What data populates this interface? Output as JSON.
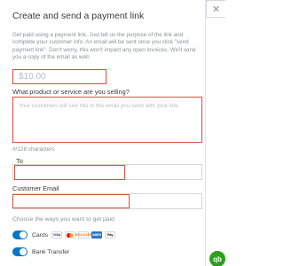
{
  "header": {
    "title": "Create and send a payment link",
    "close_icon": "close-icon"
  },
  "description": "Get paid using a payment link. Just tell us the purpose of the link and complete your customer info. An email will be sent once you click \"send payment link\". Don't worry, this won't impact any open invoices. We'll send you a copy of the email as well.",
  "amount": {
    "placeholder": "$10.00"
  },
  "product": {
    "label": "What product or service are you selling?",
    "placeholder": "Your customers will see this in the email you send with your link."
  },
  "char_count": "#/128 characters",
  "to": {
    "label": "To",
    "value": ""
  },
  "customer_email": {
    "label": "Customer Email",
    "value": ""
  },
  "payment_methods": {
    "label": "Choose the ways you want to get paid",
    "cards": {
      "label": "Cards",
      "enabled": true,
      "brands": [
        "VISA",
        "mastercard",
        "DISCOVER",
        "AMEX",
        "Pay"
      ]
    },
    "bank_transfer": {
      "label": "Bank Transfer",
      "enabled": true
    }
  },
  "colors": {
    "accent": "#0077c5",
    "highlight": "#e24b3b",
    "brand": "#2ca01c"
  },
  "logo": {
    "text": "qb"
  }
}
